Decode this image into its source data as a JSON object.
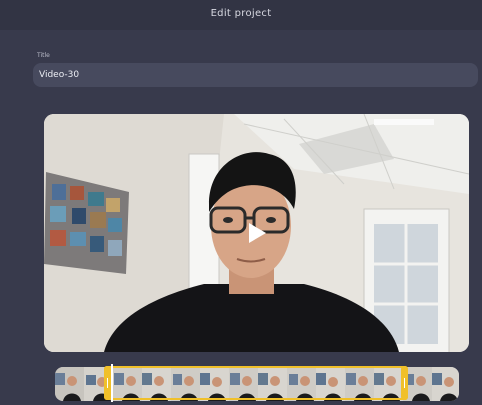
{
  "header": {
    "title": "Edit project"
  },
  "form": {
    "title_label": "Title",
    "title_value": "Video-30"
  },
  "player": {
    "play_icon": "play-icon"
  },
  "timeline": {
    "frame_count": 14,
    "selection_handles": [
      "left-trim-handle",
      "right-trim-handle"
    ]
  },
  "colors": {
    "background": "#383a4c",
    "header": "#323444",
    "input": "#474a5e",
    "accent": "#f0c02a"
  }
}
